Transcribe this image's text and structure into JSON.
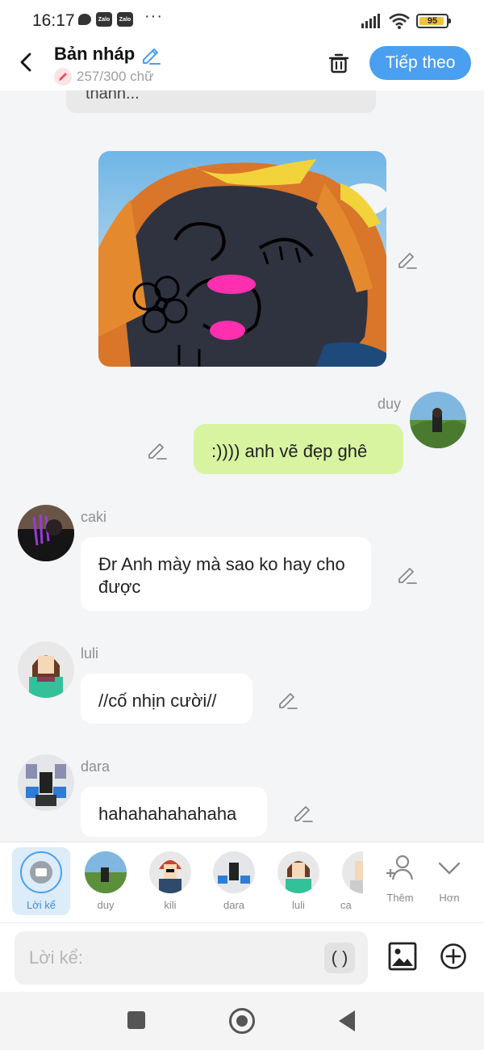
{
  "status_bar": {
    "time": "16:17",
    "battery": "95",
    "battery_level_percent": 95,
    "app_icons": [
      "chat-bubble-icon",
      "zalo-icon",
      "zalo-icon"
    ],
    "app_icon_label": "Zalo",
    "more": "···"
  },
  "header": {
    "title": "Bản nháp",
    "char_count": "257/300 chữ",
    "next_label": "Tiếp theo"
  },
  "messages": [
    {
      "type": "text",
      "sender": "",
      "text": "thành..."
    },
    {
      "type": "image",
      "sender": "",
      "description_icon": "photo-drawing"
    },
    {
      "type": "text",
      "sender": "duy",
      "text": ":)))) anh vẽ đẹp ghê",
      "side": "right"
    },
    {
      "type": "text",
      "sender": "caki",
      "text": "Đr Anh mày mà sao ko hay cho được",
      "side": "left"
    },
    {
      "type": "text",
      "sender": "luli",
      "text": "//cố nhịn cười//",
      "side": "left"
    },
    {
      "type": "text",
      "sender": "dara",
      "text": "hahahahahahaha",
      "side": "left"
    }
  ],
  "characters": [
    {
      "label": "Lời kể",
      "selected": true
    },
    {
      "label": "duy"
    },
    {
      "label": "kili"
    },
    {
      "label": "dara"
    },
    {
      "label": "luli"
    },
    {
      "label": "ca"
    }
  ],
  "more_actions": {
    "add_label": "Thêm",
    "more_label": "Hơn"
  },
  "input": {
    "placeholder": "Lời kể:",
    "paren_label": "( )"
  },
  "colors": {
    "accent": "#4a9ff0",
    "my_bubble": "#d9f4a1",
    "background": "#f4f5f7"
  }
}
